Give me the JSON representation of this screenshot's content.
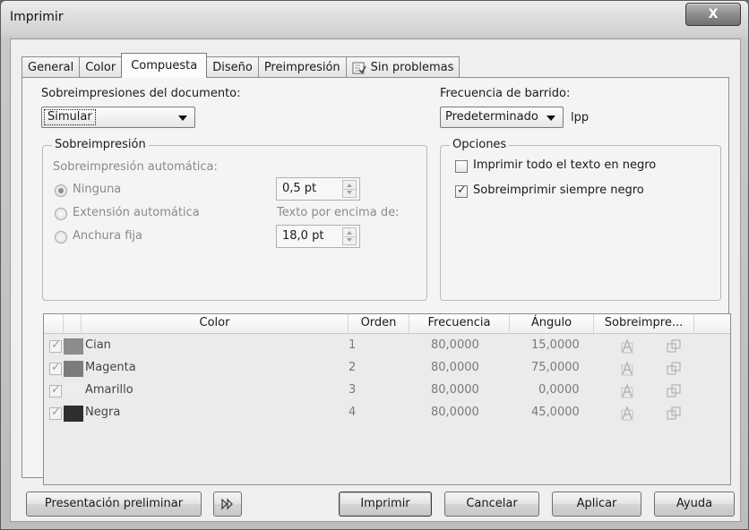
{
  "window": {
    "title": "Imprimir",
    "close_label": "X"
  },
  "tabs": [
    {
      "label": "General"
    },
    {
      "label": "Color"
    },
    {
      "label": "Compuesta",
      "active": true
    },
    {
      "label": "Diseño"
    },
    {
      "label": "Preimpresión"
    },
    {
      "label": "Sin problemas",
      "icon": "checklist-icon"
    }
  ],
  "document_overprint": {
    "label": "Sobreimpresiones del documento:",
    "value": "Simular"
  },
  "screen_frequency": {
    "label": "Frecuencia de barrido:",
    "value": "Predeterminado",
    "unit": "lpp"
  },
  "overprint_group": {
    "title": "Sobreimpresión",
    "auto_label": "Sobreimpresión automática:",
    "options": [
      {
        "label": "Ninguna",
        "checked": true
      },
      {
        "label": "Extensión automática",
        "checked": false
      },
      {
        "label": "Anchura fija",
        "checked": false
      }
    ],
    "ninguna_value": "0,5 pt",
    "text_above_label": "Texto por encima de:",
    "text_above_value": "18,0 pt"
  },
  "options_group": {
    "title": "Opciones",
    "items": [
      {
        "label": "Imprimir todo el texto en negro",
        "checked": false
      },
      {
        "label": "Sobreimprimir siempre negro",
        "checked": true
      }
    ]
  },
  "table": {
    "headers": [
      "Color",
      "Orden",
      "Frecuencia",
      "Ángulo",
      "Sobreimpre..."
    ],
    "rows": [
      {
        "checked": true,
        "color": "#8c8c8c",
        "name": "Cian",
        "order": "1",
        "frequency": "80,0000",
        "angle": "15,0000"
      },
      {
        "checked": true,
        "color": "#7c7c7c",
        "name": "Magenta",
        "order": "2",
        "frequency": "80,0000",
        "angle": "75,0000"
      },
      {
        "checked": true,
        "color": "#ededed",
        "name": "Amarillo",
        "order": "3",
        "frequency": "80,0000",
        "angle": "0,0000"
      },
      {
        "checked": true,
        "color": "#2e2e2e",
        "name": "Negra",
        "order": "4",
        "frequency": "80,0000",
        "angle": "45,0000"
      }
    ]
  },
  "buttons": {
    "preview": "Presentación preliminar",
    "print": "Imprimir",
    "cancel": "Cancelar",
    "apply": "Aplicar",
    "help": "Ayuda"
  }
}
